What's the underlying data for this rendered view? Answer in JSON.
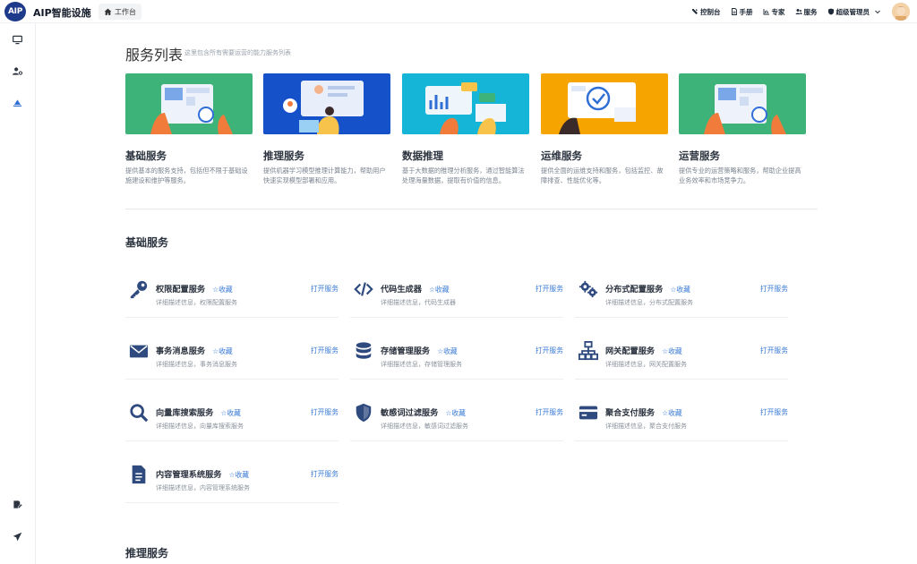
{
  "app": {
    "logo_text": "AIP",
    "title": "AIP智能设施",
    "home_tab": "工作台"
  },
  "topnav": [
    {
      "label": "控制台",
      "icon": "tools-icon"
    },
    {
      "label": "手册",
      "icon": "document-icon"
    },
    {
      "label": "专家",
      "icon": "chart-icon"
    },
    {
      "label": "服务",
      "icon": "users-icon"
    },
    {
      "label": "超级管理员",
      "icon": "shield-icon"
    }
  ],
  "sidebar": [
    "monitor-icon",
    "user-settings-icon",
    "layers-icon",
    "edit-doc-icon",
    "send-icon"
  ],
  "page": {
    "title": "服务列表",
    "subtitle": "这里包含所有需要运营的能力服务列表"
  },
  "categories": [
    {
      "name": "基础服务",
      "desc": "提供基本的服务支持，包括但不限于基础设施建设和维护等服务。",
      "color": "#3db37a"
    },
    {
      "name": "推理服务",
      "desc": "提供机器学习模型推理计算能力，帮助用户快速实现模型部署和应用。",
      "color": "#1552c9"
    },
    {
      "name": "数据推理",
      "desc": "基于大数据的推理分析服务，通过智能算法处理海量数据，提取有价值的信息。",
      "color": "#15b5d8"
    },
    {
      "name": "运维服务",
      "desc": "提供全面的运维支持和服务，包括监控、故障排查、性能优化等。",
      "color": "#f6a500"
    },
    {
      "name": "运营服务",
      "desc": "提供专业的运营策略和服务，帮助企业提高业务效率和市场竞争力。",
      "color": "#3db37a"
    }
  ],
  "sections": [
    {
      "title": "基础服务",
      "fav_label": "☆收藏",
      "open_label": "打开服务",
      "items": [
        {
          "name": "权限配置服务",
          "detail": "详细描述信息，权限配置服务",
          "icon": "key-icon"
        },
        {
          "name": "代码生成器",
          "detail": "详细描述信息，代码生成器",
          "icon": "code-icon"
        },
        {
          "name": "分布式配置服务",
          "detail": "详细描述信息，分布式配置服务",
          "icon": "gears-icon"
        },
        {
          "name": "事务消息服务",
          "detail": "详细描述信息，事务消息服务",
          "icon": "mail-icon"
        },
        {
          "name": "存储管理服务",
          "detail": "详细描述信息，存储管理服务",
          "icon": "database-icon"
        },
        {
          "name": "网关配置服务",
          "detail": "详细描述信息，网关配置服务",
          "icon": "network-icon"
        },
        {
          "name": "向量库搜索服务",
          "detail": "详细描述信息，向量库搜索服务",
          "icon": "search-icon"
        },
        {
          "name": "敏感词过滤服务",
          "detail": "详细描述信息，敏感词过滤服务",
          "icon": "shield-icon"
        },
        {
          "name": "聚合支付服务",
          "detail": "详细描述信息，聚合支付服务",
          "icon": "credit-card-icon"
        },
        {
          "name": "内容管理系统服务",
          "detail": "详细描述信息，内容管理系统服务",
          "icon": "file-icon"
        }
      ]
    },
    {
      "title": "推理服务"
    }
  ],
  "colors": {
    "accent": "#3a7bd5",
    "icon": "#2f4a7e"
  }
}
